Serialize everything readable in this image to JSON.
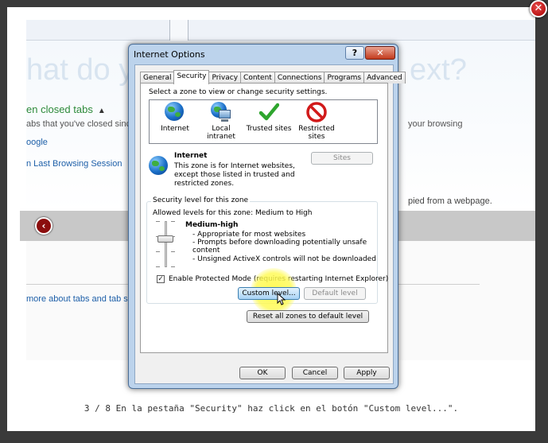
{
  "lightbox": {
    "close_symbol": "✕",
    "caption": "3 / 8   En la pestaña \"Security\" haz click en el botón \"Custom level...\"."
  },
  "background": {
    "heading_left": "hat do y",
    "heading_right": "ext?",
    "reopen_heading": "en closed tabs",
    "reopen_caret": "▲",
    "reopen_desc": "abs that you've closed since st",
    "reopen_desc_right": "your browsing",
    "google_link": "oogle",
    "last_session_link": "n Last Browsing Session",
    "copied_text": "pied from a webpage.",
    "learn_link": "more about tabs and tab sho",
    "back_symbol": "‹"
  },
  "dialog": {
    "title": "Internet Options",
    "help_symbol": "?",
    "close_symbol": "✕",
    "tabs": [
      "General",
      "Security",
      "Privacy",
      "Content",
      "Connections",
      "Programs",
      "Advanced"
    ],
    "active_tab": "Security",
    "select_zone_text": "Select a zone to view or change security settings.",
    "zones": [
      {
        "name": "Internet",
        "icon": "globe-icon"
      },
      {
        "name": "Local intranet",
        "icon": "intranet-icon"
      },
      {
        "name": "Trusted sites",
        "icon": "checkmark-icon"
      },
      {
        "name": "Restricted sites",
        "icon": "restricted-icon"
      }
    ],
    "zone_detail": {
      "heading": "Internet",
      "description_line1": "This zone is for Internet websites,",
      "description_line2": "except those listed in trusted and",
      "description_line3": "restricted zones.",
      "sites_button": "Sites"
    },
    "security_level": {
      "group_title": "Security level for this zone",
      "allowed_levels": "Allowed levels for this zone: Medium to High",
      "level_name": "Medium-high",
      "bullet1": "- Appropriate for most websites",
      "bullet2": "- Prompts before downloading potentially unsafe",
      "bullet2b": "content",
      "bullet3": "- Unsigned ActiveX controls will not be downloaded",
      "protected_mode_label": "Enable Protected Mode (requires restarting Internet Explorer)",
      "protected_mode_checked": true,
      "check_symbol": "✓",
      "custom_level_button": "Custom level...",
      "default_level_button": "Default level"
    },
    "reset_all_button": "Reset all zones to default level",
    "ok_button": "OK",
    "cancel_button": "Cancel",
    "apply_button": "Apply"
  }
}
